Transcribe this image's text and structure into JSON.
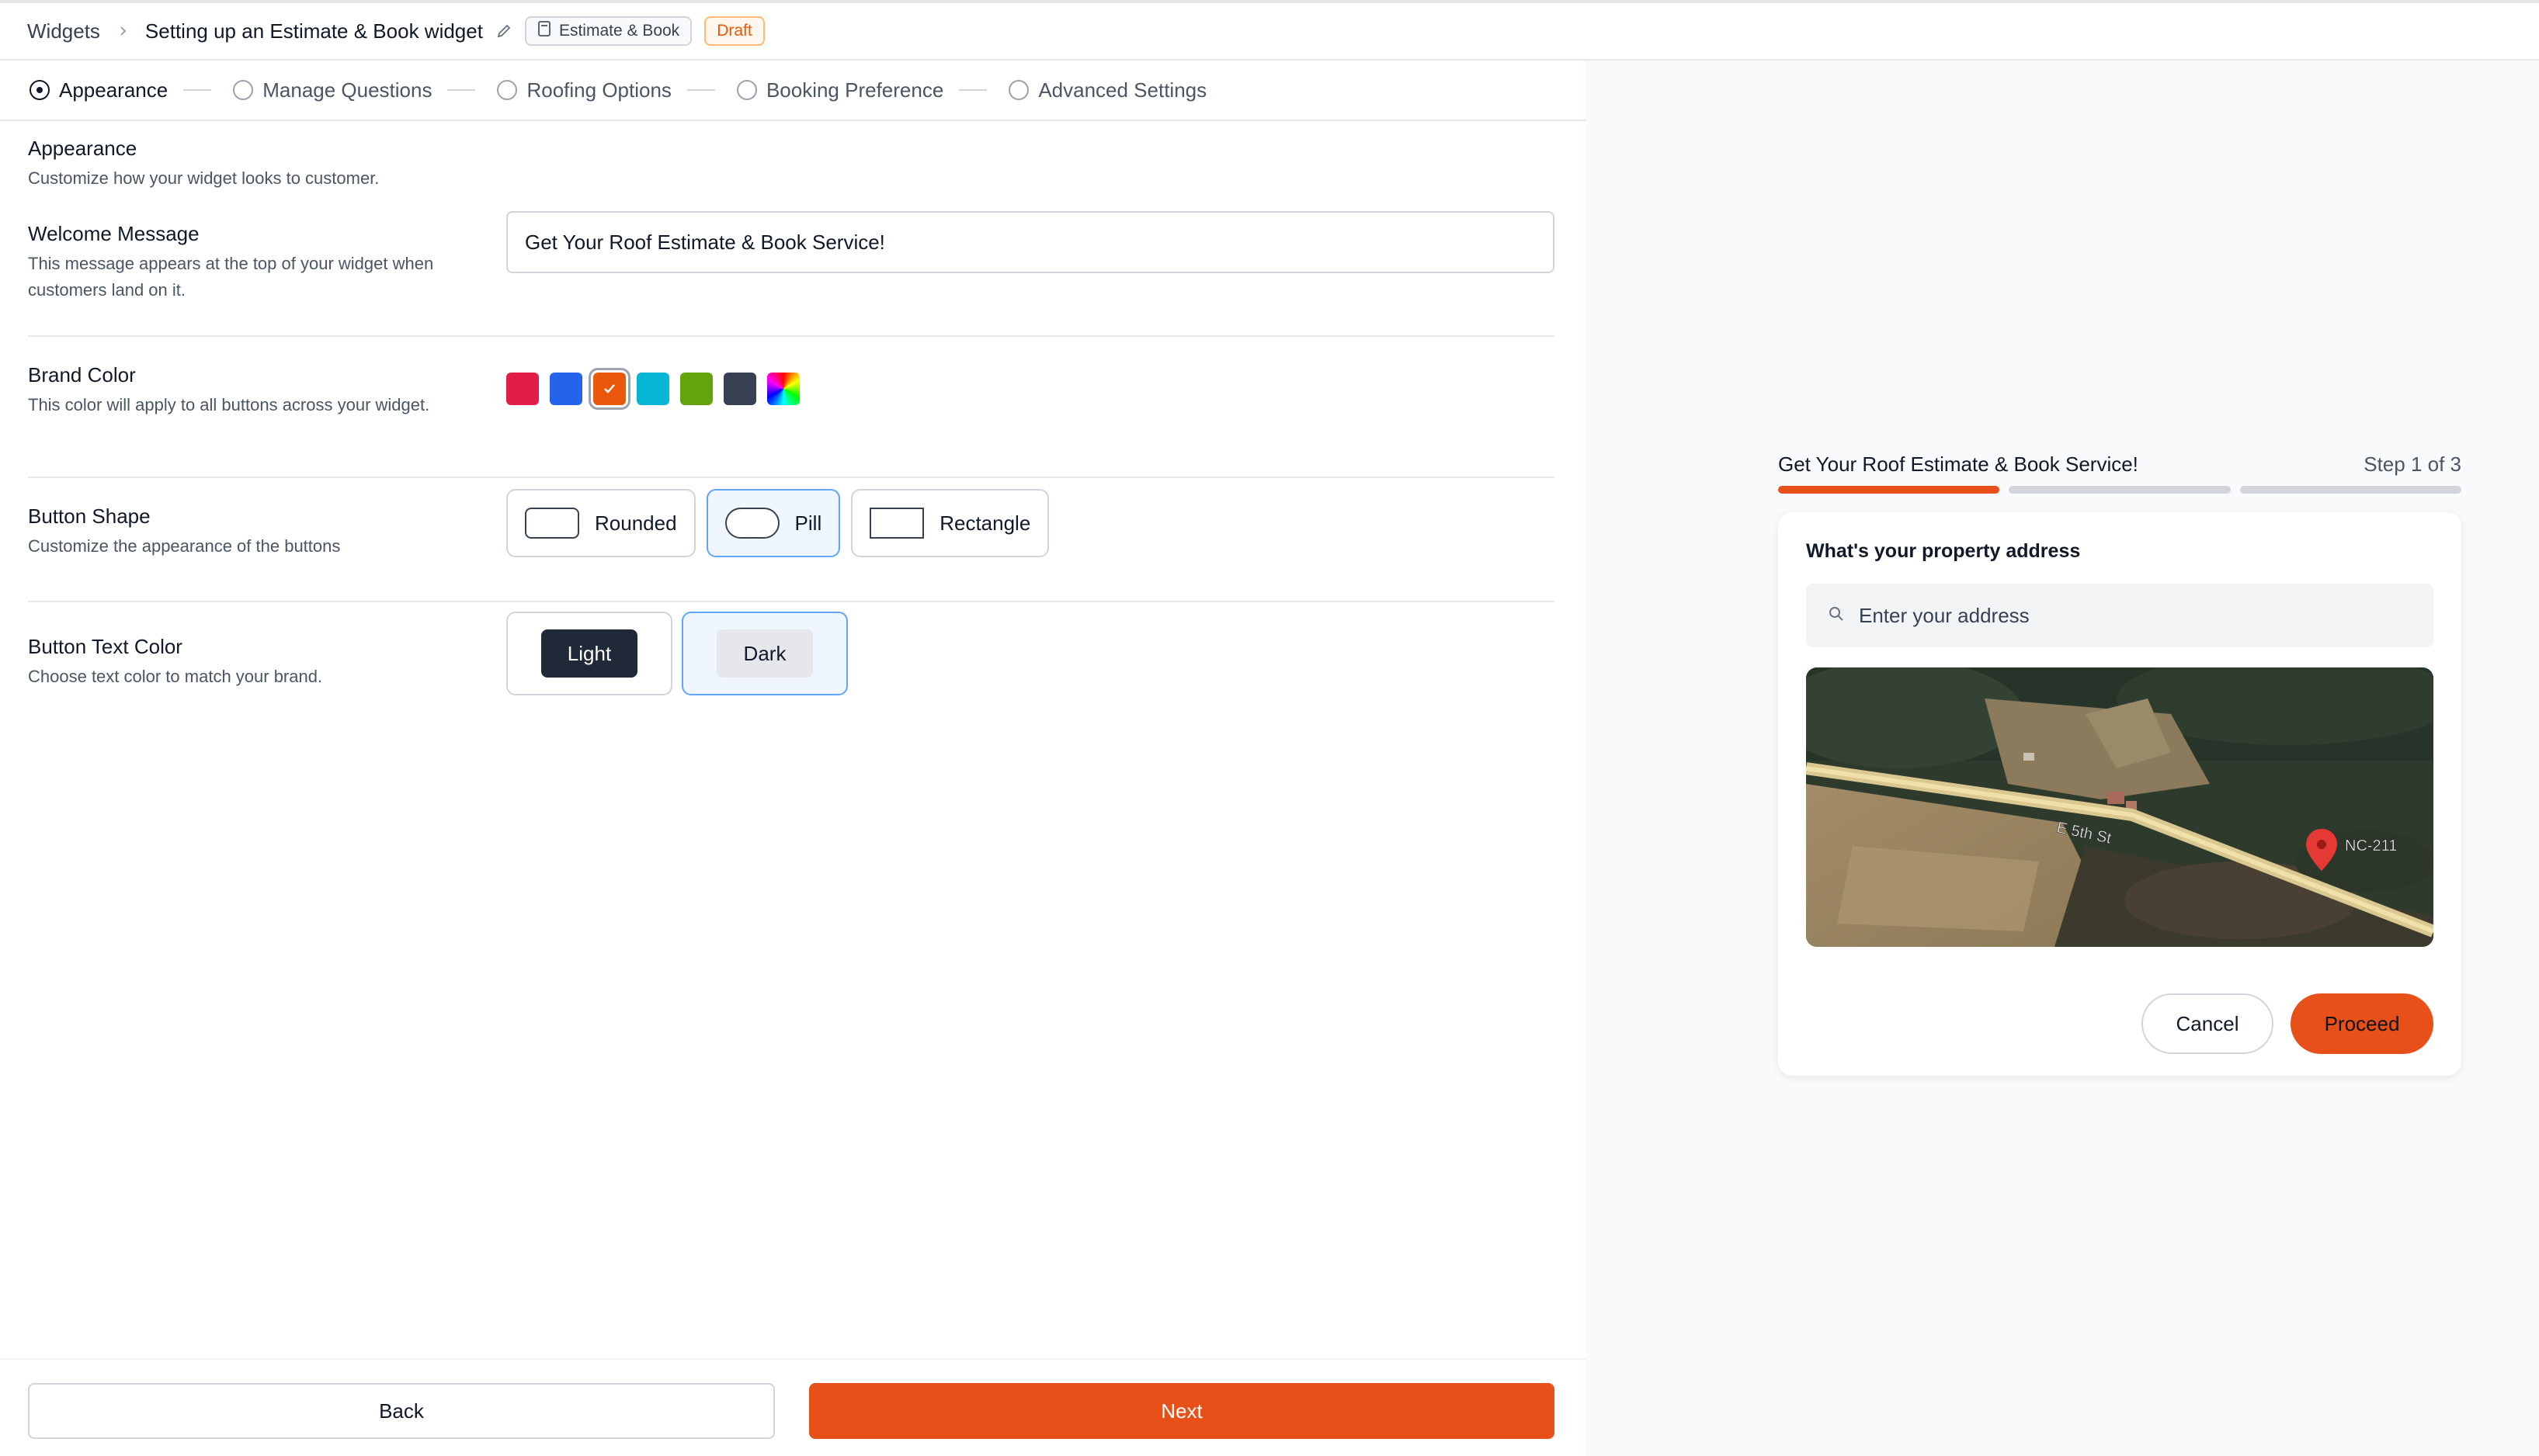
{
  "header": {
    "breadcrumb_root": "Widgets",
    "widget_title": "Setting up an Estimate & Book widget",
    "type_tag": "Estimate & Book",
    "status_tag": "Draft"
  },
  "stepper": {
    "steps": [
      {
        "label": "Appearance",
        "active": true
      },
      {
        "label": "Manage Questions",
        "active": false
      },
      {
        "label": "Roofing Options",
        "active": false
      },
      {
        "label": "Booking Preference",
        "active": false
      },
      {
        "label": "Advanced Settings",
        "active": false
      }
    ]
  },
  "appearance": {
    "title": "Appearance",
    "description": "Customize how your widget looks to customer."
  },
  "welcome": {
    "label": "Welcome Message",
    "description": "This message appears at the top of your widget when customers land on it.",
    "value": "Get Your Roof Estimate & Book Service!"
  },
  "brand": {
    "label": "Brand Color",
    "description": "This color will apply to all buttons across your widget.",
    "colors": [
      "#e11d48",
      "#2563eb",
      "#ea580c",
      "#06b6d4",
      "#65a30d",
      "#374151"
    ],
    "selected_color": "#ea580c"
  },
  "shape": {
    "label": "Button Shape",
    "description": "Customize the appearance of the buttons",
    "options": [
      "Rounded",
      "Pill",
      "Rectangle"
    ],
    "selected": "Pill"
  },
  "text_color": {
    "label": "Button Text Color",
    "description": "Choose text color to match your brand.",
    "options": [
      "Light",
      "Dark"
    ],
    "selected": "Dark"
  },
  "footer": {
    "back": "Back",
    "next": "Next"
  },
  "preview": {
    "title": "Get Your Roof Estimate & Book Service!",
    "step_text": "Step 1 of 3",
    "question": "What's your property address",
    "address_placeholder": "Enter your address",
    "map_street_label": "E 5th St",
    "map_route_label": "NC-211",
    "cancel": "Cancel",
    "proceed": "Proceed"
  },
  "colors": {
    "accent": "#e8501a"
  }
}
